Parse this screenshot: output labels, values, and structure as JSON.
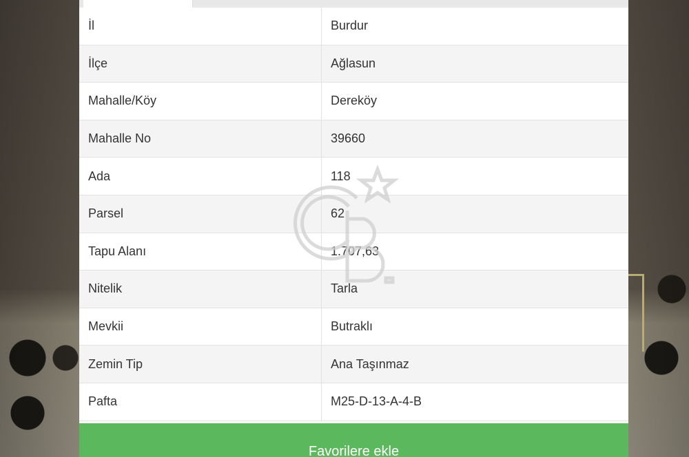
{
  "table": {
    "rows": [
      {
        "key": "İl",
        "value": "Burdur"
      },
      {
        "key": "İlçe",
        "value": "Ağlasun"
      },
      {
        "key": "Mahalle/Köy",
        "value": "Dereköy"
      },
      {
        "key": "Mahalle No",
        "value": "39660"
      },
      {
        "key": "Ada",
        "value": "118"
      },
      {
        "key": "Parsel",
        "value": "62"
      },
      {
        "key": "Tapu Alanı",
        "value": "1.707,63"
      },
      {
        "key": "Nitelik",
        "value": "Tarla"
      },
      {
        "key": "Mevkii",
        "value": "Butraklı"
      },
      {
        "key": "Zemin Tip",
        "value": "Ana Taşınmaz"
      },
      {
        "key": "Pafta",
        "value": "M25-D-13-A-4-B"
      }
    ]
  },
  "actions": {
    "favorite_label": "Favorilere ekle"
  },
  "colors": {
    "button": "#5cb85c",
    "row_alt": "#f4f4f4"
  },
  "watermark": {
    "icon": "cb-star-logo-icon"
  }
}
